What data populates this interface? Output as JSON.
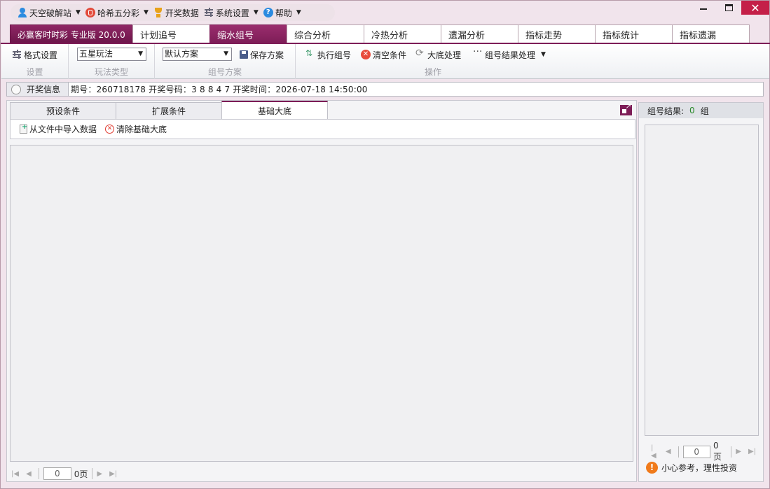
{
  "menubar": {
    "items": [
      {
        "label": "天空破解站",
        "icon": "user-icon"
      },
      {
        "label": "哈希五分彩",
        "icon": "lottery-icon"
      },
      {
        "label": "开奖数据",
        "icon": "trophy-icon"
      },
      {
        "label": "系统设置",
        "icon": "settings-sliders-icon"
      },
      {
        "label": "帮助",
        "icon": "help-icon"
      }
    ]
  },
  "window_controls": {
    "minimize": "",
    "maximize": "",
    "close": "✕"
  },
  "tabs": {
    "brand": "必赢客时时彩 专业版 20.0.0",
    "items": [
      "计划追号",
      "缩水组号",
      "综合分析",
      "冷热分析",
      "遗漏分析",
      "指标走势",
      "指标统计",
      "指标遗漏"
    ],
    "active": "缩水组号"
  },
  "ribbon": {
    "settings": {
      "format_label": "格式设置",
      "caption": "设置"
    },
    "play_type": {
      "selected": "五星玩法",
      "caption": "玩法类型"
    },
    "scheme": {
      "selected": "默认方案",
      "save_label": "保存方案",
      "caption": "组号方案"
    },
    "actions": {
      "execute_label": "执行组号",
      "clear_label": "清空条件",
      "base_label": "大底处理",
      "result_label": "组号结果处理",
      "caption": "操作"
    }
  },
  "info": {
    "label": "开奖信息",
    "text": "期号：260718178    开奖号码：3 8 8 4 7    开奖时间：2026-07-18 14:50:00"
  },
  "left": {
    "subtabs": [
      "预设条件",
      "扩展条件",
      "基础大底"
    ],
    "active_subtab": "基础大底",
    "import_label": "从文件中导入数据",
    "clear_base_label": "清除基础大底",
    "pager": {
      "page": "0",
      "suffix": "0页"
    }
  },
  "right": {
    "result_label": "组号结果:",
    "result_count": "0",
    "result_unit": "组",
    "pager": {
      "page": "0",
      "suffix": "0页"
    },
    "warning": "小心参考，理性投资"
  },
  "colors": {
    "brand": "#7d1d57",
    "count_green": "#2a8a2a",
    "close_red": "#c41f48"
  }
}
